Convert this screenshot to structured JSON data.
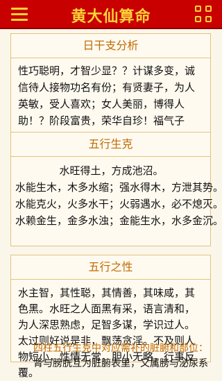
{
  "header": {
    "title": "黄大仙算命",
    "menu_icon": "hamburger-menu-icon",
    "grid_icon": "grid-apps-icon",
    "accent": "#c80000",
    "title_color": "#ffd23a"
  },
  "sections": {
    "rigan": {
      "title": "日干支分析",
      "text": "性巧聪明，才智少显？？计谋多变，诚信待人接物功名有份；有贤妻子，为人英敏，受人喜欢；女人美丽，博得人助！？阶段富贵，荣华自珍！福气子孙。"
    },
    "wuxing_shengke": {
      "title": "五行生克",
      "lines": [
        "水旺得土，方成池沼。",
        "水能生木，木多水缩；强水得木，方泄其势。",
        "水能克火，火多水干；火弱遇水，必不熄灭。",
        "水赖金生，金多水浊；金能生水，水多金沉。"
      ]
    },
    "wuxing_zhixing": {
      "title": "五行之性",
      "text": "水主智，其性聪，其情善，其味咸，其色黑。水旺之人面黑有采，语言清和，为人深思熟虑，足智多谋，学识过人。太过则好说是非，飘荡贪淫。不及则人物短小，性情无常，胆小无略，行事反覆。"
    },
    "bottom": {
      "title": "四柱五行生克中对应需补的脏腑和部位：",
      "text": "肾与膀胱互为脏腑表里，又属膀与泌尿系"
    }
  }
}
